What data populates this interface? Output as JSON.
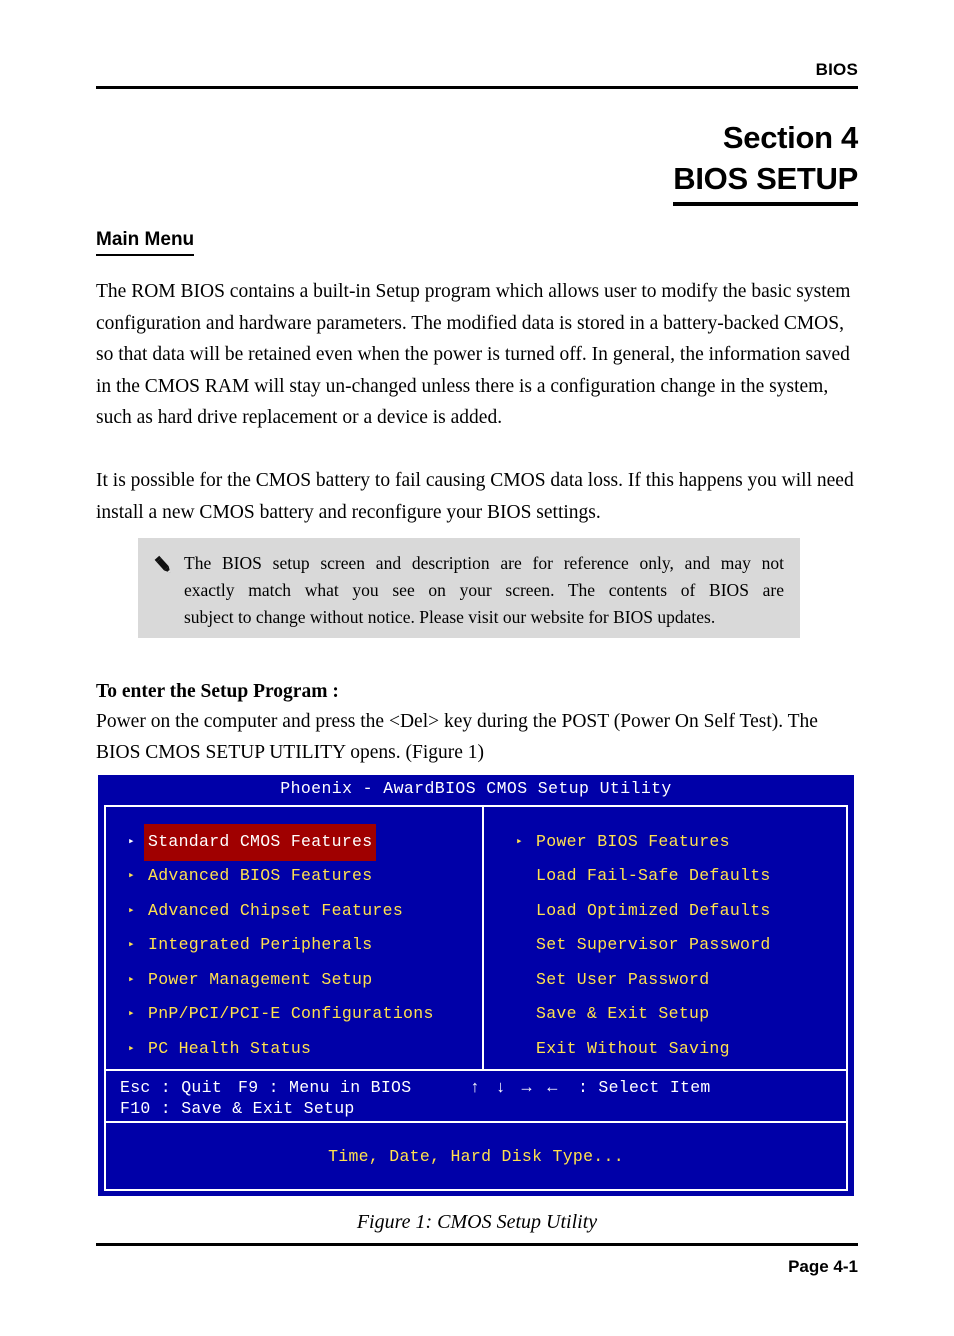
{
  "header": {
    "label": "BIOS"
  },
  "section": {
    "number": "Section 4",
    "name": "BIOS SETUP"
  },
  "main_menu": {
    "heading": "Main Menu",
    "paragraph_1": "The ROM BIOS contains a built-in Setup program which allows user to modify the basic system configuration and hardware parameters. The modified data is stored in a battery-backed CMOS, so that data will be retained even when the power is turned off. In general, the information saved in the CMOS RAM will stay un-changed unless there is a configuration change in the system, such as hard drive replacement or a device is added.",
    "paragraph_2": "It is possible for the CMOS battery to fail causing CMOS data loss. If this happens you will need install a new CMOS battery and reconfigure your BIOS settings."
  },
  "note": {
    "icon": "pencil-icon",
    "line_1": "The BIOS setup screen and description are for reference only, and may not",
    "line_2": "exactly match what you see on your screen. The contents of BIOS are",
    "line_3": "subject to change without notice.  Please visit our website for BIOS updates."
  },
  "setup_program": {
    "heading": "To enter the Setup Program :",
    "paragraph": "Power on the computer and press the <Del> key during the POST (Power On Self Test). The BIOS CMOS SETUP UTILITY opens. (Figure 1)"
  },
  "bios_screen": {
    "title": "Phoenix - AwardBIOS CMOS Setup Utility",
    "colors": {
      "background": "#0000a8",
      "border": "#ffffff",
      "menu_text": "#ffe14d",
      "title_text": "#ffffff",
      "highlight_background": "#a00000",
      "highlight_text": "#ffffff"
    },
    "left_menu": [
      {
        "marker": "▸",
        "label": "Standard CMOS Features",
        "selected": true
      },
      {
        "marker": "▸",
        "label": "Advanced BIOS Features",
        "selected": false
      },
      {
        "marker": "▸",
        "label": "Advanced Chipset Features",
        "selected": false
      },
      {
        "marker": "▸",
        "label": "Integrated Peripherals",
        "selected": false
      },
      {
        "marker": "▸",
        "label": "Power Management Setup",
        "selected": false
      },
      {
        "marker": "▸",
        "label": "PnP/PCI/PCI-E Configurations",
        "selected": false
      },
      {
        "marker": "▸",
        "label": "PC Health Status",
        "selected": false
      }
    ],
    "right_menu": [
      {
        "marker": "▸",
        "label": "Power BIOS Features",
        "selected": false,
        "has_marker": true
      },
      {
        "marker": "",
        "label": "Load Fail-Safe Defaults",
        "selected": false,
        "has_marker": false
      },
      {
        "marker": "",
        "label": "Load Optimized Defaults",
        "selected": false,
        "has_marker": false
      },
      {
        "marker": "",
        "label": "Set Supervisor Password",
        "selected": false,
        "has_marker": false
      },
      {
        "marker": "",
        "label": "Set User Password",
        "selected": false,
        "has_marker": false
      },
      {
        "marker": "",
        "label": "Save & Exit Setup",
        "selected": false,
        "has_marker": false
      },
      {
        "marker": "",
        "label": "Exit Without Saving",
        "selected": false,
        "has_marker": false
      }
    ],
    "help_bar": {
      "esc": "Esc : Quit",
      "f9": "F9 : Menu in BIOS",
      "arrows": "↑ ↓ → ←",
      "select_item": ": Select Item",
      "f10": "F10 : Save & Exit Setup"
    },
    "status_line": "Time, Date, Hard Disk Type..."
  },
  "figure": {
    "caption": "Figure 1:  CMOS Setup Utility"
  },
  "footer": {
    "page_label": "Page 4-1"
  }
}
